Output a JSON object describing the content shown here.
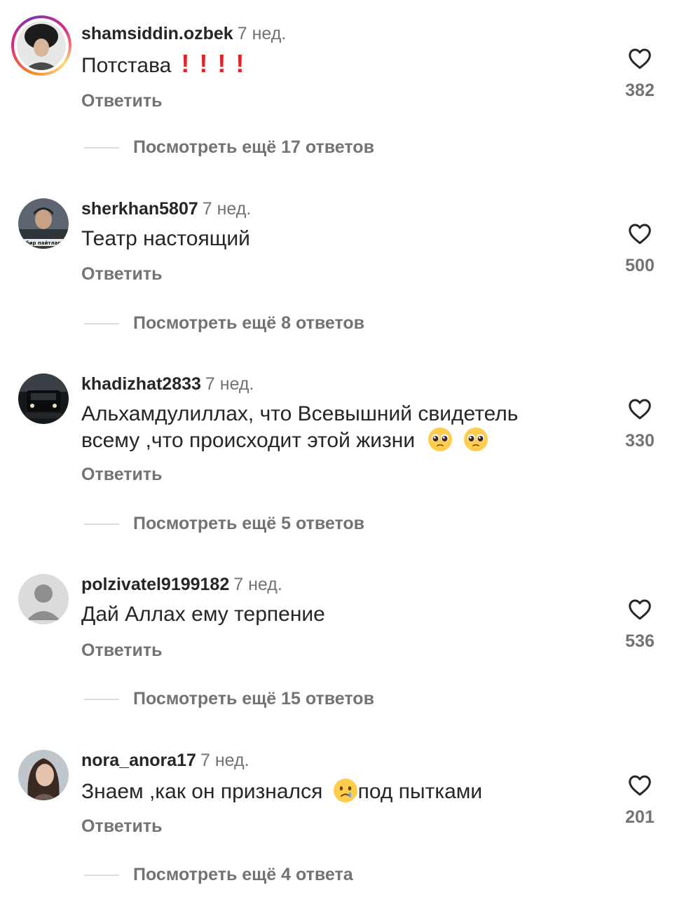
{
  "comments": [
    {
      "username": "shamsiddin.ozbek",
      "time": "7 нед.",
      "text": "Потстава",
      "reply_label": "Ответить",
      "likes": "382",
      "more_replies": "Посмотреть ещё 17 ответов"
    },
    {
      "username": "sherkhan5807",
      "time": "7 нед.",
      "text": "Театр настоящий",
      "avatar_caption": "бир пайтлар",
      "reply_label": "Ответить",
      "likes": "500",
      "more_replies": "Посмотреть ещё 8 ответов"
    },
    {
      "username": "khadizhat2833",
      "time": "7 нед.",
      "text_line1": "Альхамдулиллах, что Всевышний свидетель",
      "text_line2": "всему ,что происходит этой жизни",
      "reply_label": "Ответить",
      "likes": "330",
      "more_replies": "Посмотреть ещё 5 ответов"
    },
    {
      "username": "polzivatel9199182",
      "time": "7 нед.",
      "text": "Дай Аллах ему терпение",
      "reply_label": "Ответить",
      "likes": "536",
      "more_replies": "Посмотреть ещё 15 ответов"
    },
    {
      "username": "nora_anora17",
      "time": "7 нед.",
      "text_before": "Знаем ,как он признался",
      "text_after": "под пытками",
      "reply_label": "Ответить",
      "likes": "201",
      "more_replies": "Посмотреть ещё 4 ответа"
    }
  ],
  "colors": {
    "primary_text": "#262626",
    "secondary_text": "#737373",
    "exclamation": "#e0242e"
  },
  "icons": {
    "like": "heart-outline-icon",
    "exclamation": "red-exclamation-emoji",
    "pleading": "pleading-face-emoji",
    "crying": "crying-face-emoji"
  }
}
